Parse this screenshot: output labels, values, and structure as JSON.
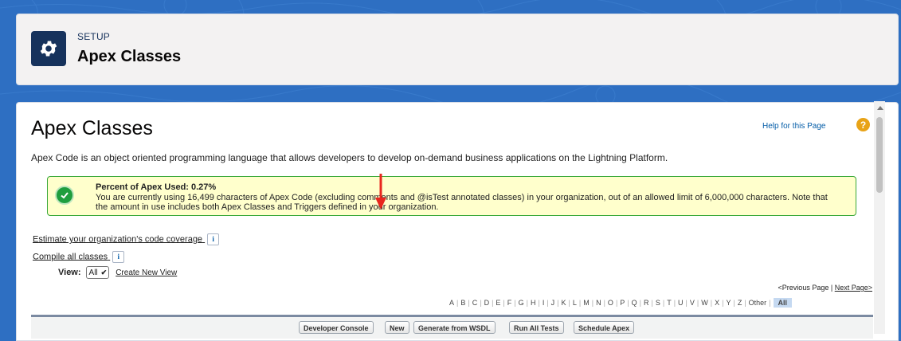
{
  "header": {
    "section": "SETUP",
    "title": "Apex Classes"
  },
  "main": {
    "title": "Apex Classes",
    "help_link": "Help for this Page",
    "description": "Apex Code is an object oriented programming language that allows developers to develop on-demand business applications on the Lightning Platform.",
    "info": {
      "title": "Percent of Apex Used: 0.27%",
      "text": "You are currently using 16,499 characters of Apex Code (excluding comments and @isTest annotated classes) in your organization, out of an allowed limit of 6,000,000 characters. Note that the amount in use includes both Apex Classes and Triggers defined in your organization."
    },
    "links": {
      "estimate": "Estimate your organization's code coverage",
      "compile": "Compile all classes"
    },
    "view": {
      "label": "View:",
      "selected": "All",
      "create": "Create New View"
    },
    "pager": {
      "previous": "<Previous Page",
      "separator": "|",
      "next": "Next Page>"
    },
    "alphabet": [
      "A",
      "B",
      "C",
      "D",
      "E",
      "F",
      "G",
      "H",
      "I",
      "J",
      "K",
      "L",
      "M",
      "N",
      "O",
      "P",
      "Q",
      "R",
      "S",
      "T",
      "U",
      "V",
      "W",
      "X",
      "Y",
      "Z",
      "Other"
    ],
    "alphabet_active": "All",
    "toolbar": {
      "developer_console": "Developer Console",
      "new": "New",
      "generate_wsdl": "Generate from WSDL",
      "run_all_tests": "Run All Tests",
      "schedule_apex": "Schedule Apex"
    }
  },
  "icons": {
    "header": "gear-icon",
    "help": "help-icon",
    "success": "checkmark-icon",
    "info": "info-icon",
    "annotation": "red-arrow-icon"
  },
  "colors": {
    "background": "#2e6fc2",
    "header_tile": "#16325c",
    "info_border": "#39a839",
    "info_bg": "#ffffcc",
    "arrow": "#e8271e",
    "link": "#015ba7"
  }
}
